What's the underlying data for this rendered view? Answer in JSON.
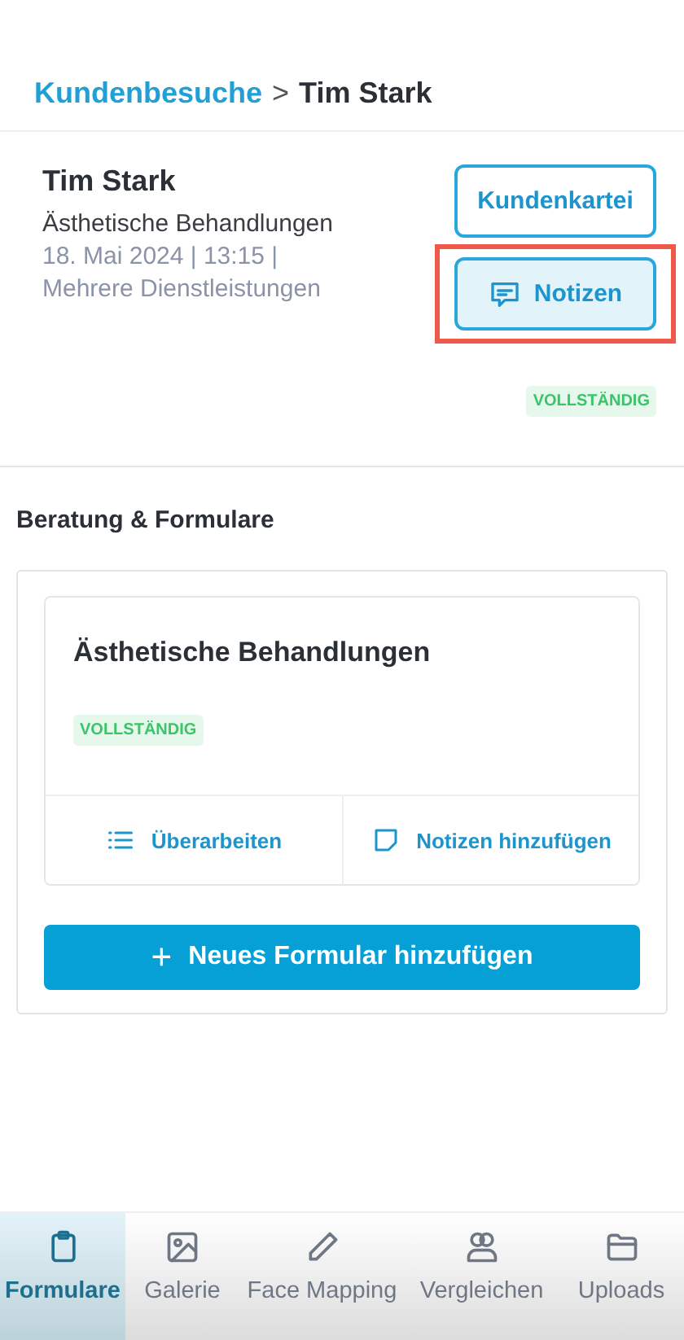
{
  "breadcrumb": {
    "parent": "Kundenbesuche",
    "separator": ">",
    "current": "Tim Stark"
  },
  "visit": {
    "client_name": "Tim Stark",
    "treatment": "Ästhetische Behandlungen",
    "date_line": "18. Mai 2024 | 13:15 |",
    "services": "Mehrere Dienstleistungen",
    "status": "VOLLSTÄNDIG",
    "buttons": [
      {
        "label": "Kundenkartei",
        "kind": "outline",
        "highlighted": false
      },
      {
        "label": "Notizen",
        "kind": "notes",
        "highlighted": true
      }
    ]
  },
  "section_title": "Beratung & Formulare",
  "forms": [
    {
      "title": "Ästhetische Behandlungen",
      "status": "VOLLSTÄNDIG",
      "actions": [
        {
          "label": "Überarbeiten",
          "kind": "edit"
        },
        {
          "label": "Notizen hinzufügen",
          "kind": "note"
        }
      ]
    }
  ],
  "add_button": {
    "icon": "+",
    "label": "Neues Formular hinzufügen"
  },
  "tabs": [
    {
      "label": "Formulare",
      "kind": "clipboard",
      "selected": true
    },
    {
      "label": "Galerie",
      "kind": "image",
      "selected": false
    },
    {
      "label": "Face Mapping",
      "kind": "pencil",
      "selected": false
    },
    {
      "label": "Vergleichen",
      "kind": "users",
      "selected": false
    },
    {
      "label": "Uploads",
      "kind": "folder",
      "selected": false
    }
  ]
}
